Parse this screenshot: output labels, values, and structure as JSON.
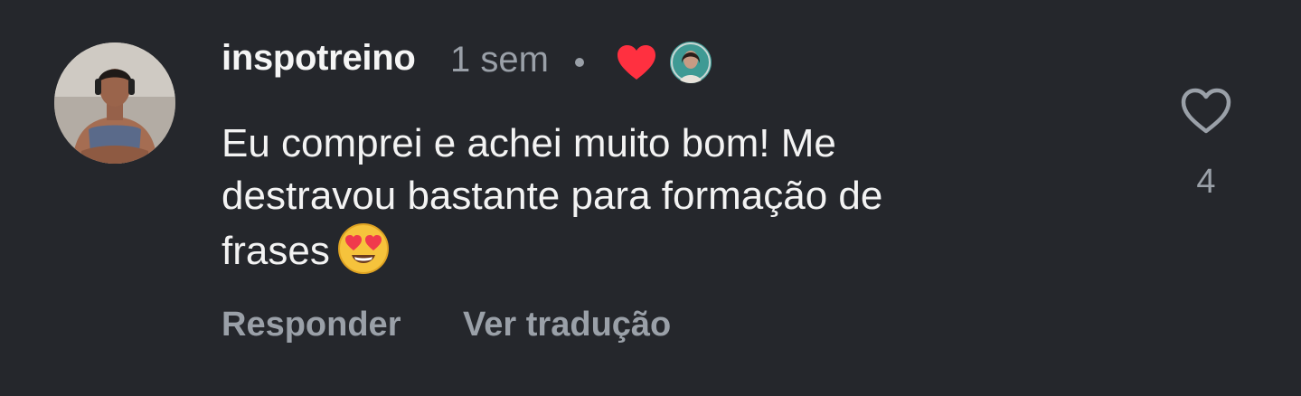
{
  "comment": {
    "username": "inspotreino",
    "time_ago": "1 sem",
    "separator": "•",
    "text_lines": [
      "Eu comprei e achei muito bom! Me",
      "destravou bastante para formação de",
      "frases"
    ],
    "emoji": "smiling-face-with-heart-eyes",
    "creator_liked": true,
    "like_count": "4"
  },
  "actions": {
    "reply_label": "Responder",
    "translate_label": "Ver tradução"
  },
  "colors": {
    "background": "#25272c",
    "primary_text": "#f3f3f3",
    "secondary_text": "#9aa0a8",
    "heart_red": "#ff3040"
  },
  "icons": {
    "like": "heart-outline-icon",
    "creator_like": "heart-filled-icon"
  }
}
